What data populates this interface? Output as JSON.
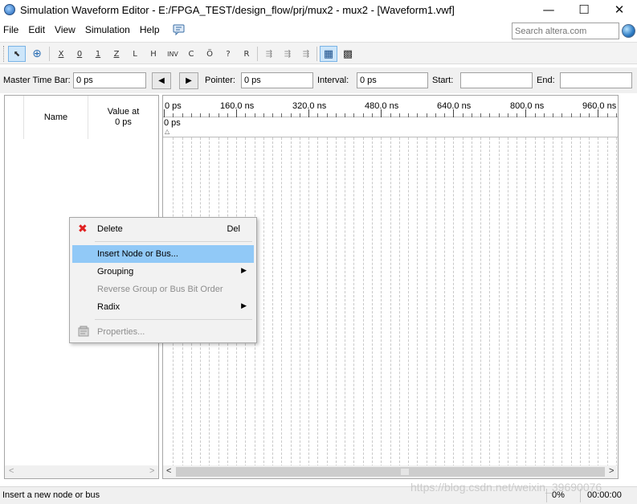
{
  "window": {
    "title": "Simulation Waveform Editor - E:/FPGA_TEST/design_flow/prj/mux2 - mux2 - [Waveform1.vwf]",
    "minimize_glyph": "—",
    "maximize_glyph": "☐",
    "close_glyph": "✕"
  },
  "menubar": {
    "items": [
      "File",
      "Edit",
      "View",
      "Simulation",
      "Help"
    ],
    "search_placeholder": "Search altera.com"
  },
  "toolbar": {
    "buttons": [
      {
        "name": "selection-tool-icon",
        "glyph": "⬉"
      },
      {
        "name": "zoom-tool-icon",
        "glyph": "⊕"
      },
      {
        "name": "force-unknown-icon",
        "glyph": "X"
      },
      {
        "name": "force-low-icon",
        "glyph": "0"
      },
      {
        "name": "force-high-icon",
        "glyph": "1"
      },
      {
        "name": "force-high-impedance-icon",
        "glyph": "Z"
      },
      {
        "name": "force-weak-low-icon",
        "glyph": "L"
      },
      {
        "name": "force-weak-high-icon",
        "glyph": "H"
      },
      {
        "name": "invert-icon",
        "glyph": "INV"
      },
      {
        "name": "count-value-icon",
        "glyph": "C"
      },
      {
        "name": "clock-icon",
        "glyph": "Ö"
      },
      {
        "name": "arbitrary-value-icon",
        "glyph": "?"
      },
      {
        "name": "random-value-icon",
        "glyph": "R"
      },
      {
        "name": "snap-to-grid-icon",
        "glyph": "⇶"
      },
      {
        "name": "snap-to-transition-icon",
        "glyph": "⇶"
      },
      {
        "name": "snap-disabled-icon",
        "glyph": "⇶"
      },
      {
        "name": "functional-simulation-icon",
        "glyph": "▦"
      },
      {
        "name": "timing-simulation-icon",
        "glyph": "▩"
      }
    ]
  },
  "timebar": {
    "master_time_bar_label": "Master Time Bar:",
    "master_time_bar_value": "0 ps",
    "prev_glyph": "◀",
    "next_glyph": "▶",
    "pointer_label": "Pointer:",
    "pointer_value": "0 ps",
    "interval_label": "Interval:",
    "interval_value": "0 ps",
    "start_label": "Start:",
    "start_value": "",
    "end_label": "End:",
    "end_value": ""
  },
  "node_panel": {
    "name_header": "Name",
    "value_header_line1": "Value at",
    "value_header_line2": "0 ps",
    "scroll_left_glyph": "<",
    "scroll_right_glyph": ">"
  },
  "waveform": {
    "time_labels": [
      "0 ps",
      "160.0 ns",
      "320.0 ns",
      "480.0 ns",
      "640.0 ns",
      "800.0 ns",
      "960.0 ns"
    ],
    "cursor_label": "0 ps",
    "cursor_glyph": "△",
    "scroll_left_glyph": "<",
    "scroll_right_glyph": ">"
  },
  "context_menu": {
    "items": [
      {
        "label": "Delete",
        "shortcut": "Del",
        "icon": "delete-icon",
        "enabled": true,
        "submenu": false
      },
      {
        "label": "Insert Node or Bus...",
        "shortcut": "",
        "icon": "",
        "enabled": true,
        "submenu": false,
        "highlighted": true
      },
      {
        "label": "Grouping",
        "shortcut": "",
        "icon": "",
        "enabled": true,
        "submenu": true
      },
      {
        "label": "Reverse Group or Bus Bit Order",
        "shortcut": "",
        "icon": "",
        "enabled": false,
        "submenu": false
      },
      {
        "label": "Radix",
        "shortcut": "",
        "icon": "",
        "enabled": true,
        "submenu": true
      },
      {
        "label": "Properties...",
        "shortcut": "",
        "icon": "properties-icon",
        "enabled": false,
        "submenu": false
      }
    ],
    "submenu_glyph": "▶",
    "delete_glyph": "✖"
  },
  "statusbar": {
    "text": "Insert a new node or bus",
    "percent": "0%",
    "time": "00:00:00"
  },
  "watermark": "https://blog.csdn.net/weixin_39690076",
  "colors": {
    "menu_highlight": "#91c9f7",
    "toolbar_selected": "#cde6fa",
    "delete_red": "#e02020"
  }
}
